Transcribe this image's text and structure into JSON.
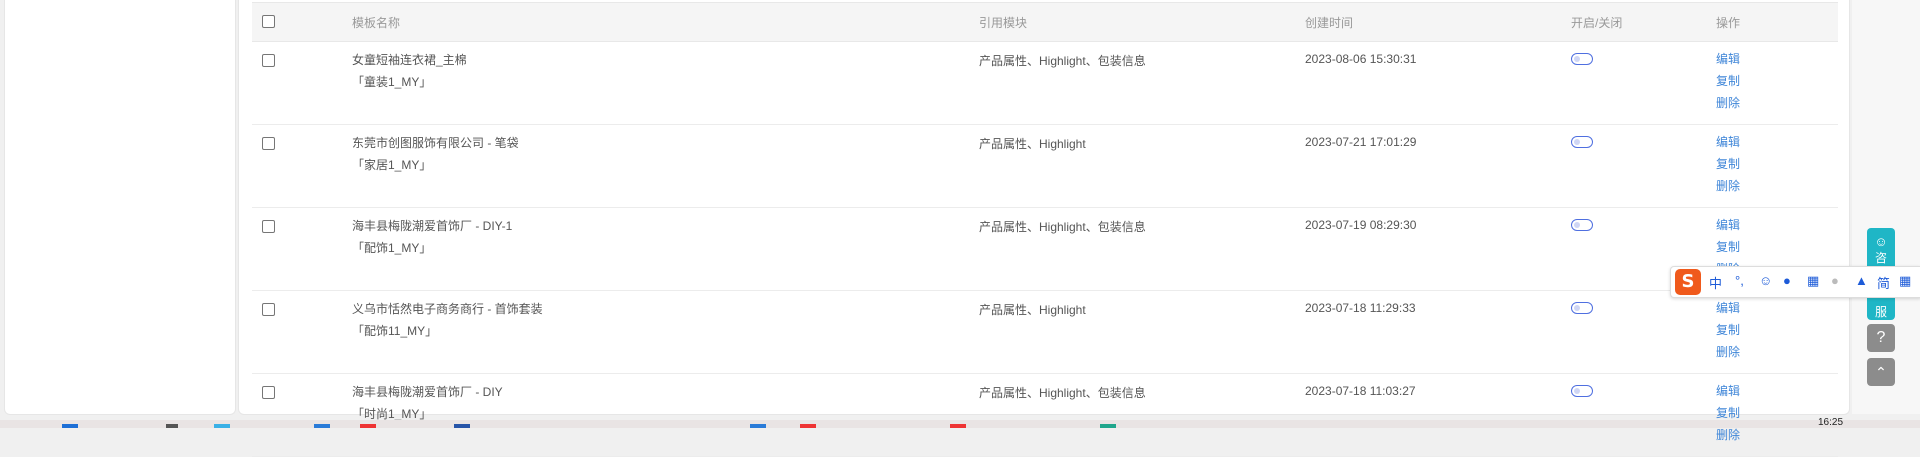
{
  "table": {
    "headers": {
      "name": "模板名称",
      "modules": "引用模块",
      "created": "创建时间",
      "toggle": "开启/关闭",
      "actions": "操作"
    },
    "rows": [
      {
        "name": "女童短袖连衣裙_主棉",
        "category": "「童装1_MY」",
        "modules": "产品属性、Highlight、包装信息",
        "created": "2023-08-06 15:30:31",
        "edit": "编辑",
        "copy": "复制",
        "delete": "删除"
      },
      {
        "name": "东莞市创图服饰有限公司 - 笔袋",
        "category": "「家居1_MY」",
        "modules": "产品属性、Highlight",
        "created": "2023-07-21 17:01:29",
        "edit": "编辑",
        "copy": "复制",
        "delete": "删除"
      },
      {
        "name": "海丰县梅陇潮爱首饰厂 - DIY-1",
        "category": "「配饰1_MY」",
        "modules": "产品属性、Highlight、包装信息",
        "created": "2023-07-19 08:29:30",
        "edit": "编辑",
        "copy": "复制",
        "delete": "删除"
      },
      {
        "name": "义乌市恬然电子商务商行 - 首饰套装",
        "category": "「配饰11_MY」",
        "modules": "产品属性、Highlight",
        "created": "2023-07-18 11:29:33",
        "edit": "编辑",
        "copy": "复制",
        "delete": "删除"
      },
      {
        "name": "海丰县梅陇潮爱首饰厂 - DIY",
        "category": "「时尚1_MY」",
        "modules": "产品属性、Highlight、包装信息",
        "created": "2023-07-18 11:03:27",
        "edit": "编辑",
        "copy": "复制",
        "delete": "删除"
      }
    ]
  },
  "consult": {
    "l1": "咨",
    "l2": "询",
    "l3": "服"
  },
  "help": "?",
  "ime": {
    "logo": "S",
    "mode": "中",
    "punct": "°,",
    "simp": "简"
  },
  "clock": "16:25",
  "colors": {
    "accent": "#3f86d8",
    "toggle": "#4f6fe0",
    "consult": "#1fb6c6"
  }
}
